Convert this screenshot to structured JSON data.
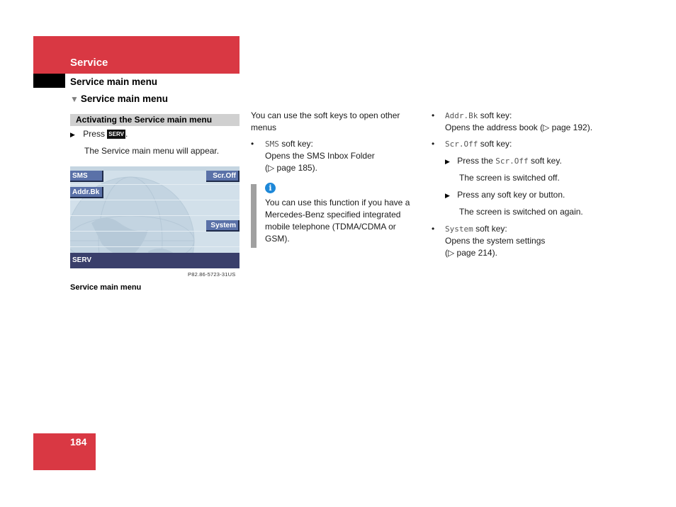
{
  "header": {
    "section": "Service",
    "subtitle": "Service main menu",
    "subsection": "Service main menu"
  },
  "left_column": {
    "bar_heading": "Activating the Service main menu",
    "step_press": "Press",
    "key_label": "SERV",
    "step_press_end": ".",
    "step_result": "The Service main menu will appear.",
    "display": {
      "softkeys": {
        "sms": "SMS",
        "addr_bk": "Addr.Bk",
        "scr_off": "Scr.Off",
        "system": "System"
      },
      "bottom_label": "SERV"
    },
    "figure_code": "P82.86-5723-31US",
    "caption": "Service main menu"
  },
  "middle_column": {
    "intro": "You can use the soft keys to open other menus",
    "items": [
      {
        "key": "SMS",
        "label": " soft key:",
        "line2": "Opens the SMS Inbox Folder",
        "line3": "(▷ page 185)."
      }
    ],
    "info": {
      "icon": "info-icon",
      "text": "You can use this function if you have a Mercedes-Benz specified integrated mobile telephone (TDMA/CDMA or GSM)."
    }
  },
  "right_column": {
    "addr": {
      "key": "Addr.Bk",
      "label": " soft key:",
      "line2": "Opens the address book (▷ page 192)."
    },
    "scr": {
      "key": "Scr.Off",
      "label": " soft key:",
      "step1_pre": "Press the ",
      "step1_key": "Scr.Off",
      "step1_post": " soft key.",
      "step1_result": "The screen is switched off.",
      "step2": "Press any soft key or button.",
      "step2_result": "The screen is switched on again."
    },
    "system": {
      "key": "System",
      "label": " soft key:",
      "line2": "Opens the system settings",
      "line3": "(▷ page 214)."
    }
  },
  "footer": {
    "page_number": "184"
  },
  "colors": {
    "brand_red": "#d93843",
    "softkey_blue": "#5a71a8",
    "display_bar": "#3a3f6b",
    "info_blue": "#1e88d8"
  }
}
